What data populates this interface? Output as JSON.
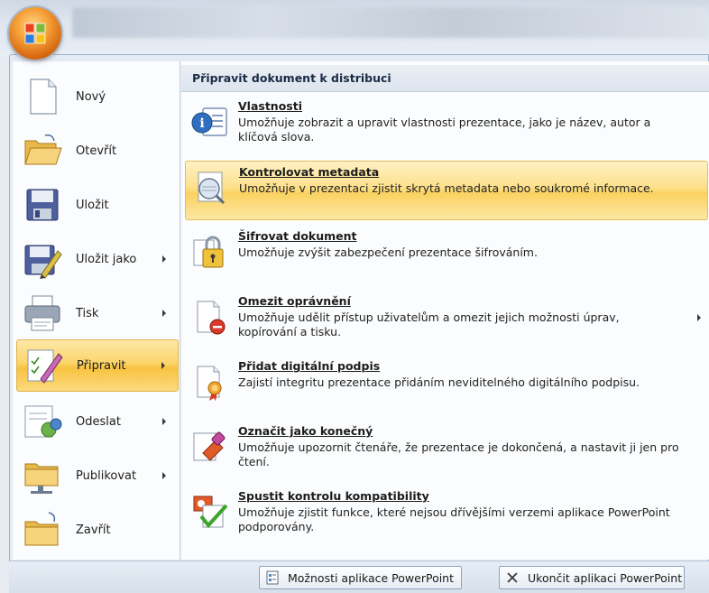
{
  "left_menu": {
    "items": [
      {
        "label": "Nový"
      },
      {
        "label": "Otevřít"
      },
      {
        "label": "Uložit"
      },
      {
        "label": "Uložit jako"
      },
      {
        "label": "Tisk"
      },
      {
        "label": "Připravit"
      },
      {
        "label": "Odeslat"
      },
      {
        "label": "Publikovat"
      },
      {
        "label": "Zavřít"
      }
    ]
  },
  "prepare_panel": {
    "header": "Připravit dokument k distribuci",
    "items": [
      {
        "title": "Vlastnosti",
        "description": "Umožňuje zobrazit a upravit vlastnosti prezentace, jako je název, autor a klíčová slova."
      },
      {
        "title": "Kontrolovat metadata",
        "description": "Umožňuje v prezentaci zjistit skrytá metadata nebo soukromé informace."
      },
      {
        "title": "Šifrovat dokument",
        "description": "Umožňuje zvýšit zabezpečení prezentace šifrováním."
      },
      {
        "title": "Omezit oprávnění",
        "description": "Umožňuje udělit přístup uživatelům a omezit jejich možnosti úprav, kopírování a tisku."
      },
      {
        "title": "Přidat digitální podpis",
        "description": "Zajistí integritu prezentace přidáním neviditelného digitálního podpisu."
      },
      {
        "title": "Označit jako konečný",
        "description": "Umožňuje upozornit čtenáře, že prezentace je dokončená, a nastavit ji jen pro čtení."
      },
      {
        "title": "Spustit kontrolu kompatibility",
        "description": "Umožňuje zjistit funkce, které nejsou dřívějšími verzemi aplikace PowerPoint podporovány."
      }
    ]
  },
  "bottom_bar": {
    "options_label": "Možnosti aplikace PowerPoint",
    "exit_label": "Ukončit aplikaci PowerPoint"
  },
  "colors": {
    "highlight": "#fbd56a",
    "menu_bg": "#fbfcfd",
    "frame_bg": "#e4ebf4"
  }
}
